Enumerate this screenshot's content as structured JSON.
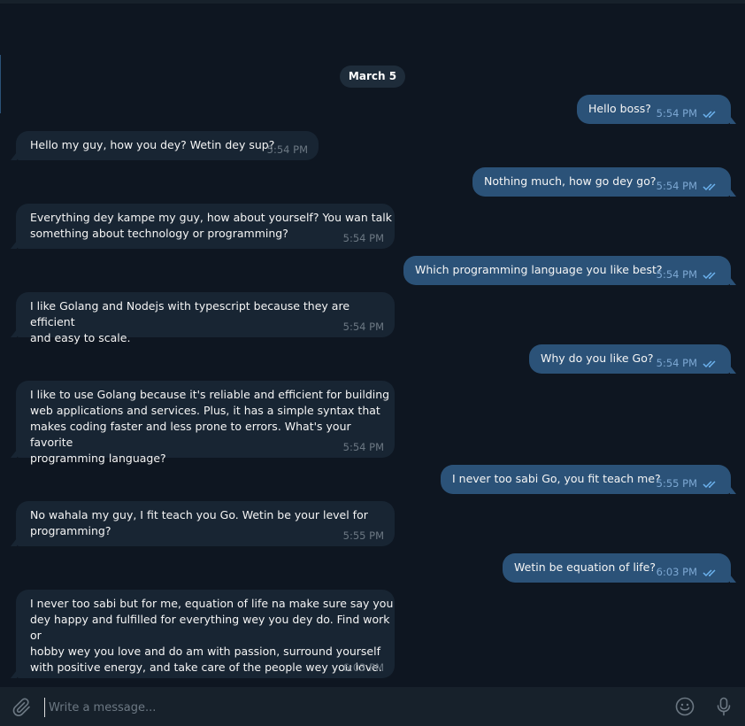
{
  "chat": {
    "date_label": "March 5",
    "messages": [
      {
        "dir": "out",
        "text": "Hello boss?",
        "time": "5:54 PM"
      },
      {
        "dir": "in",
        "text": "Hello my guy, how you dey? Wetin dey sup?",
        "time": "5:54 PM"
      },
      {
        "dir": "out",
        "text": "Nothing much, how go dey go?",
        "time": "5:54 PM"
      },
      {
        "dir": "in",
        "text": "Everything dey kampe my guy, how about yourself? You wan talk\nsomething about technology or programming?",
        "time": "5:54 PM"
      },
      {
        "dir": "out",
        "text": "Which programming language you like best?",
        "time": "5:54 PM"
      },
      {
        "dir": "in",
        "text": "I like Golang and Nodejs with typescript because they are efficient\nand easy to scale.",
        "time": "5:54 PM"
      },
      {
        "dir": "out",
        "text": "Why do you like Go?",
        "time": "5:54 PM"
      },
      {
        "dir": "in",
        "text": "I like to use Golang because it's reliable and efficient for building\nweb applications and services. Plus, it has a simple syntax that\nmakes coding faster and less prone to errors. What's your favorite\nprogramming language?",
        "time": "5:54 PM"
      },
      {
        "dir": "out",
        "text": "I never too sabi Go, you fit teach me?",
        "time": "5:55 PM"
      },
      {
        "dir": "in",
        "text": "No wahala my guy, I fit teach you Go. Wetin be your level for\nprogramming?",
        "time": "5:55 PM"
      },
      {
        "dir": "out",
        "text": "Wetin be equation of life?",
        "time": "6:03 PM"
      },
      {
        "dir": "in",
        "text": "I never too sabi but for me, equation of life na make sure say you\ndey happy and fulfilled for everything wey you dey do. Find work or\nhobby wey you love and do am with passion, surround yourself\nwith positive energy, and take care of the people wey you love.",
        "time": "6:03 PM"
      }
    ]
  },
  "composer": {
    "placeholder": "Write a message...",
    "attach_icon": "paperclip-icon",
    "emoji_icon": "smiley-icon",
    "mic_icon": "microphone-icon"
  },
  "colors": {
    "background": "#0e1621",
    "incoming_bubble": "#182533",
    "outgoing_bubble": "#2b5278",
    "time_in": "#6c7883",
    "time_out": "#7da8d3",
    "ticks": "#6cb3ef"
  }
}
